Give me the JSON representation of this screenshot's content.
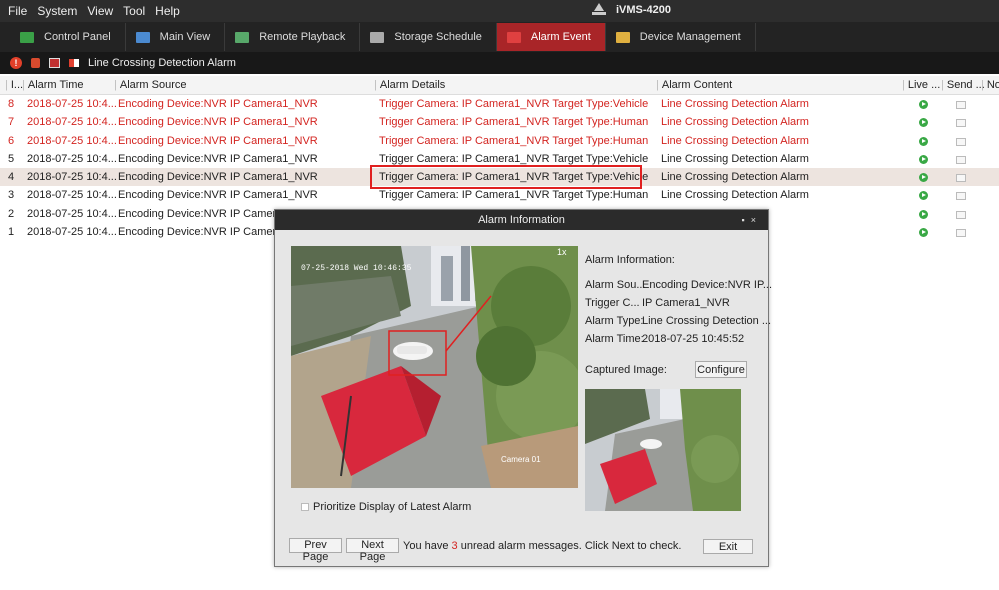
{
  "menu": [
    "File",
    "System",
    "View",
    "Tool",
    "Help"
  ],
  "app_title": "iVMS-4200",
  "tabs": [
    {
      "label": "Control Panel",
      "icon": "control-panel-icon",
      "color": "#3aa047"
    },
    {
      "label": "Main View",
      "icon": "main-view-icon",
      "color": "#4b8ad0"
    },
    {
      "label": "Remote Playback",
      "icon": "remote-playback-icon",
      "color": "#58a86a"
    },
    {
      "label": "Storage Schedule",
      "icon": "storage-schedule-icon",
      "color": "#aaaaaa"
    },
    {
      "label": "Alarm Event",
      "icon": "alarm-event-icon",
      "color": "#e04040"
    },
    {
      "label": "Device Management",
      "icon": "device-management-icon",
      "color": "#e0b040"
    }
  ],
  "alarm_bar": {
    "label": "Line Crossing Detection Alarm"
  },
  "columns": [
    "I...",
    "Alarm Time",
    "Alarm Source",
    "Alarm Details",
    "Alarm Content",
    "Live ...",
    "Send ...",
    "No"
  ],
  "rows": [
    {
      "index": "8",
      "time": "2018-07-25 10:4...",
      "source": "Encoding Device:NVR IP Camera1_NVR",
      "details": "Trigger Camera: IP Camera1_NVR Target Type:Vehicle",
      "content": "Line Crossing Detection Alarm",
      "unread": true
    },
    {
      "index": "7",
      "time": "2018-07-25 10:4...",
      "source": "Encoding Device:NVR IP Camera1_NVR",
      "details": "Trigger Camera: IP Camera1_NVR Target Type:Human",
      "content": "Line Crossing Detection Alarm",
      "unread": true
    },
    {
      "index": "6",
      "time": "2018-07-25 10:4...",
      "source": "Encoding Device:NVR IP Camera1_NVR",
      "details": "Trigger Camera: IP Camera1_NVR Target Type:Human",
      "content": "Line Crossing Detection Alarm",
      "unread": true
    },
    {
      "index": "5",
      "time": "2018-07-25 10:4...",
      "source": "Encoding Device:NVR IP Camera1_NVR",
      "details": "Trigger Camera: IP Camera1_NVR Target Type:Vehicle",
      "content": "Line Crossing Detection Alarm",
      "unread": false
    },
    {
      "index": "4",
      "time": "2018-07-25 10:4...",
      "source": "Encoding Device:NVR IP Camera1_NVR",
      "details": "Trigger Camera: IP Camera1_NVR Target Type:Vehicle",
      "content": "Line Crossing Detection Alarm",
      "unread": false,
      "selected": true
    },
    {
      "index": "3",
      "time": "2018-07-25 10:4...",
      "source": "Encoding Device:NVR IP Camera1_NVR",
      "details": "Trigger Camera: IP Camera1_NVR Target Type:Human",
      "content": "Line Crossing Detection Alarm",
      "unread": false
    },
    {
      "index": "2",
      "time": "2018-07-25 10:4...",
      "source": "Encoding Device:NVR IP Camera1_NVR",
      "details": "",
      "content": "n Alarm",
      "unread": false
    },
    {
      "index": "1",
      "time": "2018-07-25 10:4...",
      "source": "Encoding Device:NVR IP Camera1_NVR",
      "details": "",
      "content": "n Alarm",
      "unread": false
    }
  ],
  "dialog": {
    "title": "Alarm Information",
    "video_timestamp": "07-25-2018 Wed 10:46:35",
    "video_zoom": "1x",
    "video_camera_label": "Camera 01",
    "info_header": "Alarm Information:",
    "info": [
      {
        "label": "Alarm Sou...",
        "value": "Encoding Device:NVR IP..."
      },
      {
        "label": "Trigger C...",
        "value": "IP Camera1_NVR"
      },
      {
        "label": "Alarm Type:",
        "value": "Line Crossing Detection ..."
      },
      {
        "label": "Alarm Time:",
        "value": "2018-07-25 10:45:52"
      }
    ],
    "captured_label": "Captured Image:",
    "configure_label": "Configure",
    "prioritize_label": "Prioritize Display of Latest Alarm",
    "prev_label": "Prev Page",
    "next_label": "Next Page",
    "msg_before": "You have ",
    "unread_count": "3",
    "msg_after": " unread alarm messages. Click Next to check.",
    "exit_label": "Exit"
  },
  "colors": {
    "accent": "#a92528",
    "unread_text": "#d32420",
    "highlight_box": "#e02020"
  }
}
